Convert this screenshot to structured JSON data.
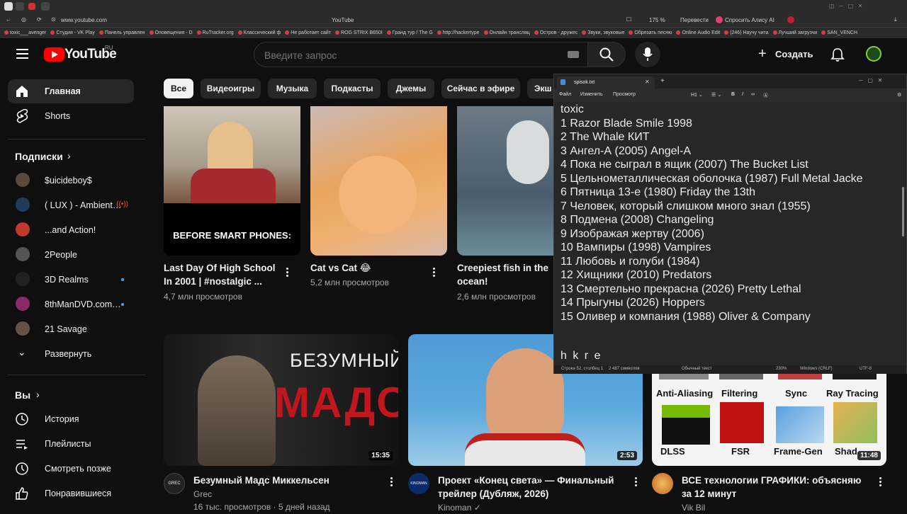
{
  "browser": {
    "url": "www.youtube.com",
    "tab_title": "YouTube",
    "zoom": "175 %",
    "translate_label": "Перевести",
    "alice_label": "Спросить Алису AI",
    "bookmarks": [
      "toxic___avenger",
      "Студия - VK Play",
      "Панель управлен",
      "Оповещения - D",
      "RuTracker.org",
      "Классический ф",
      "Не работает сайт",
      "ROG STRIX B650I",
      "Гранд тур / The G",
      "http://hackertype",
      "Онлайн трансляц",
      "Остров - дружес",
      "Звуки, звуковые",
      "Обрезать песню",
      "Online Audio Edit",
      "(246) Научу чита",
      "Лучший загрузчи",
      "SAN_VENCH"
    ]
  },
  "header": {
    "logo_text": "YouTube",
    "region": "RU",
    "search_placeholder": "Введите запрос",
    "create_label": "Создать"
  },
  "sidebar": {
    "home": "Главная",
    "shorts": "Shorts",
    "subscriptions_title": "Подписки",
    "subscriptions": [
      {
        "name": "$uicideboy$",
        "color": "#5a4a3a"
      },
      {
        "name": "( LUX ) - Ambient…",
        "color": "#1e3c5c"
      },
      {
        "name": "...and Action!",
        "color": "#c0392b"
      },
      {
        "name": "2People",
        "color": "#555555"
      },
      {
        "name": "3D Realms",
        "color": "#222222"
      },
      {
        "name": "8thManDVD.com…",
        "color": "#8a2a6a"
      },
      {
        "name": "21 Savage",
        "color": "#6a5040"
      }
    ],
    "expand": "Развернуть",
    "you_title": "Вы",
    "you_items": [
      "История",
      "Плейлисты",
      "Смотреть позже",
      "Понравившиеся"
    ]
  },
  "chips": [
    "Все",
    "Видеоигры",
    "Музыка",
    "Подкасты",
    "Джемы",
    "Сейчас в эфире",
    "Экш"
  ],
  "videos_row1": [
    {
      "title": "Last Day Of High School In 2001 | #nostalgic ...",
      "meta": "4,7 млн просмотров",
      "thumb_text": "BEFORE SMART PHONES:"
    },
    {
      "title": "Cat vs Cat 😂",
      "meta": "5,2 млн просмотров"
    },
    {
      "title": "Creepiest fish in the ocean!",
      "meta": "2,6 млн просмотров"
    }
  ],
  "videos_row2": [
    {
      "title": "Безумный Мадс Миккельсен",
      "channel": "Grec",
      "meta": "16 тыс. просмотров · 5 дней назад",
      "duration": "15:35",
      "thumb_text1": "БЕЗУМНЫЙ",
      "thumb_text2": "МАДС",
      "avatar_text": "GREC"
    },
    {
      "title": "Проект «Конец света» — Финальный трейлер (Дубляж, 2026)",
      "channel": "Kinoman ✓",
      "duration": "2:53",
      "avatar_text": "KINOMAN"
    },
    {
      "title": "ВСЕ технологии ГРАФИКИ: объясняю за 12 минут",
      "channel": "Vik Bil",
      "duration": "11:48",
      "tiles": [
        "Anti-Aliasing",
        "Filtering",
        "Sync",
        "Ray Tracing",
        "DLSS",
        "FSR",
        "Frame-Gen",
        "Shad"
      ],
      "tile_logos": [
        "NVIDIA DLSS",
        "AMD FSR"
      ]
    }
  ],
  "notepad": {
    "tab_title": "spisok.txt",
    "menu": [
      "Файл",
      "Изменить",
      "Просмотр"
    ],
    "lines": [
      "    toxic",
      "1  Razor Blade Smile 1998",
      "2  The Whale КИТ",
      "3  Ангел-А (2005) Angel-A",
      "4  Пока не сыграл в ящик (2007) The Bucket List",
      "5  Цельнометаллическая оболочка (1987) Full Metal Jacke",
      "6  Пятница 13-е (1980) Friday the 13th",
      "7  Человек, который слишком много знал  (1955)",
      "8  Подмена (2008) Changeling",
      "9  Изображая жертву (2006)",
      "10 Вампиры (1998) Vampires",
      "11 Любовь и голуби (1984)",
      "12 Хищники (2010) Predators",
      "13 Смертельно прекрасна (2026) Pretty Lethal",
      "14 Прыгуны (2026) Hoppers",
      "15 Оливер и компания (1988) Oliver & Company"
    ],
    "trailing_line": "    h k r e",
    "status": {
      "position": "Строка 52, столбец 1",
      "chars": "2 487 символов",
      "format": "Обычный текст",
      "zoom": "230%",
      "line_ending": "Windows (CRLF)",
      "encoding": "UTF-8"
    }
  }
}
